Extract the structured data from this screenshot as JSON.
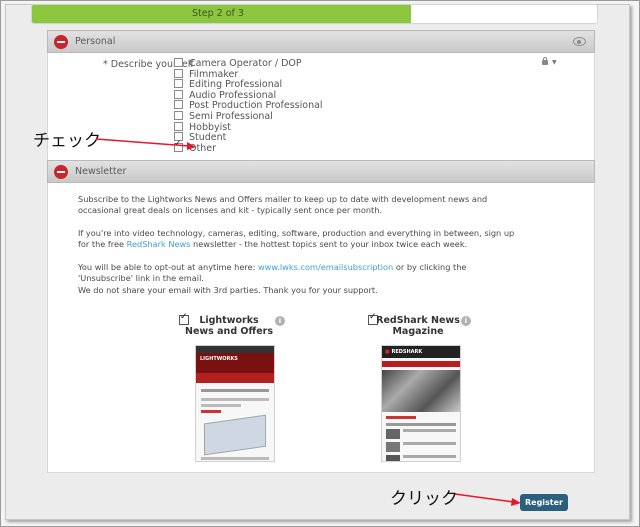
{
  "progress": {
    "label": "Step 2 of 3",
    "value": 0.67,
    "color": "#8cc63f"
  },
  "personal": {
    "title": "Personal",
    "field_label": "* Describe yourself",
    "options": [
      {
        "label": "Camera Operator / DOP",
        "checked": false
      },
      {
        "label": "Filmmaker",
        "checked": false
      },
      {
        "label": "Editing Professional",
        "checked": false
      },
      {
        "label": "Audio Professional",
        "checked": false
      },
      {
        "label": "Post Production Professional",
        "checked": false
      },
      {
        "label": "Semi Professional",
        "checked": false
      },
      {
        "label": "Hobbyist",
        "checked": false
      },
      {
        "label": "Student",
        "checked": false
      },
      {
        "label": "Other",
        "checked": true
      }
    ]
  },
  "annotations": {
    "check": "チェック",
    "click": "クリック",
    "arrow_color": "#e3172d"
  },
  "newsletter": {
    "title": "Newsletter",
    "para1": "Subscribe to the Lightworks News and Offers mailer to keep up to date with development news and occasional great deals on licenses and kit - typically sent once per month.",
    "para2_a": "If you're into video technology, cameras, editing, software, production and everything in between, sign up for the free ",
    "para2_link": "RedShark News",
    "para2_b": " newsletter - the hottest topics sent to your inbox twice each week.",
    "para3_a": "You will be able to opt-out at anytime here: ",
    "para3_link": "www.lwks.com/emailsubscription",
    "para3_b": " or by clicking the 'Unsubscribe' link in the email.",
    "para4": "We do not share your email with 3rd parties. Thank you for your support.",
    "items": [
      {
        "title_line1": "Lightworks",
        "title_line2": "News and Offers",
        "checked": true
      },
      {
        "title_line1": "RedShark News",
        "title_line2": "Magazine",
        "checked": true
      }
    ],
    "thumb1": {
      "banner": "LIGHTWORKS"
    },
    "thumb2": {
      "brand": "REDSHARK"
    }
  },
  "register_label": "Register"
}
